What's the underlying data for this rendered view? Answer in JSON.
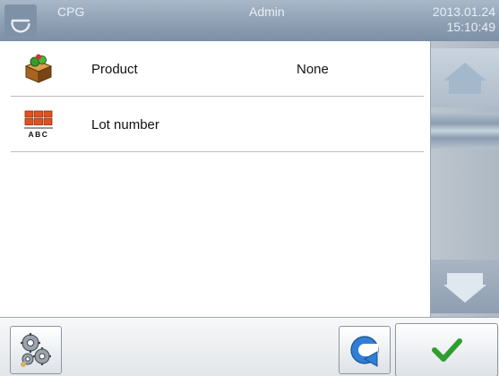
{
  "header": {
    "app_name": "CPG",
    "user": "Admin",
    "date": "2013.01.24",
    "time": "15:10:49",
    "logo_letter": "e"
  },
  "list": {
    "items": [
      {
        "icon": "product-box-icon",
        "label": "Product",
        "value": "None"
      },
      {
        "icon": "lot-number-grid-icon",
        "label": "Lot number",
        "value": "",
        "icon_caption": "ABC"
      }
    ]
  },
  "scroll": {
    "up_icon": "house-up-icon",
    "down_icon": "arrow-down-icon"
  },
  "toolbar": {
    "settings_icon": "gears-icon",
    "back_icon": "return-arrow-icon",
    "ok_icon": "checkmark-icon"
  },
  "colors": {
    "header": "#8fa0b4",
    "accent_green": "#2e9e2e",
    "separator": "#b9bdc2"
  }
}
